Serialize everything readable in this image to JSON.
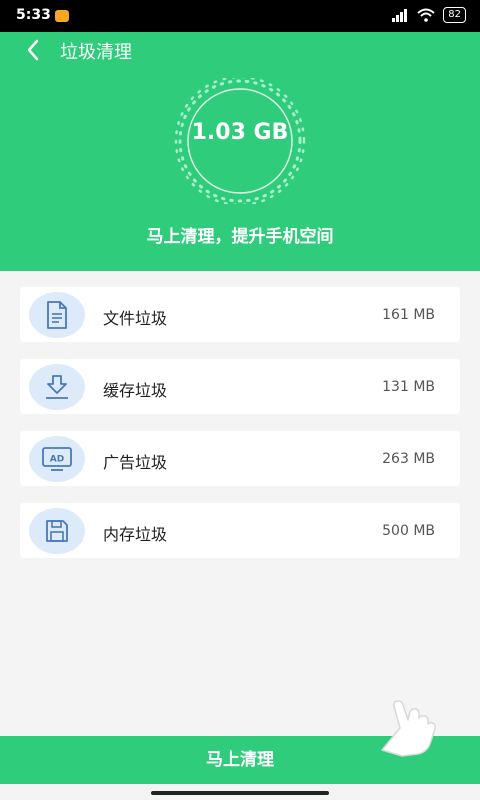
{
  "status_bar": {
    "time": "5:33",
    "battery": "82"
  },
  "header": {
    "title": "垃圾清理"
  },
  "summary": {
    "total_size": "1.03 GB",
    "tagline": "马上清理，提升手机空间"
  },
  "items": [
    {
      "label": "文件垃圾",
      "size": "161 MB",
      "icon": "file-icon"
    },
    {
      "label": "缓存垃圾",
      "size": "131 MB",
      "icon": "download-icon"
    },
    {
      "label": "广告垃圾",
      "size": "263 MB",
      "icon": "ad-icon"
    },
    {
      "label": "内存垃圾",
      "size": "500 MB",
      "icon": "memory-icon"
    }
  ],
  "clean_button": {
    "label": "马上清理"
  },
  "colors": {
    "primary": "#2ecc7b",
    "icon_bg": "#dceafa",
    "icon_stroke": "#4a78b5"
  }
}
